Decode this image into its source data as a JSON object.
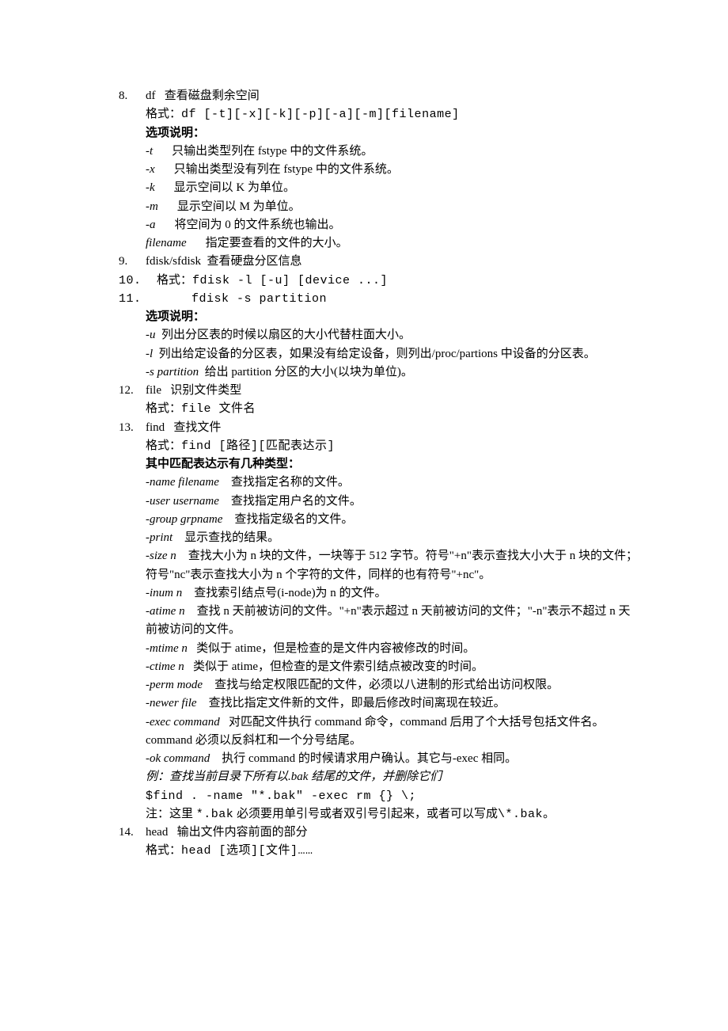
{
  "s8": {
    "num": "8.",
    "title_cmd": "df",
    "title_desc": "查看磁盘剩余空间",
    "format_label": "格式：",
    "format_code": "df [-t][-x][-k][-p][-a][-m][filename]",
    "options_label": "选项说明：",
    "opts": [
      {
        "flag": "-t",
        "desc": "只输出类型列在 fstype 中的文件系统。"
      },
      {
        "flag": "-x",
        "desc": "只输出类型没有列在 fstype 中的文件系统。"
      },
      {
        "flag": "-k",
        "desc": "显示空间以 K 为单位。"
      },
      {
        "flag": "-m",
        "desc": "显示空间以 M 为单位。"
      },
      {
        "flag": "-a",
        "desc": "将空间为 0 的文件系统也输出。"
      }
    ],
    "filename_flag": "filename",
    "filename_desc": "指定要查看的文件的大小。"
  },
  "s9": {
    "num": "9.",
    "title_cmd": "fdisk/sfdisk",
    "title_desc": "查看硬盘分区信息"
  },
  "s10": {
    "num": "10.",
    "label": "格式：",
    "code": "fdisk -l [-u] [device ...]"
  },
  "s11": {
    "num": "11.",
    "code": "fdisk -s partition",
    "options_label": "选项说明：",
    "opt_u_flag": "-u",
    "opt_u_desc": "列出分区表的时候以扇区的大小代替柱面大小。",
    "opt_l_flag": "-l",
    "opt_l_desc": "列出给定设备的分区表，如果没有给定设备，则列出/proc/partions 中设备的分区表。",
    "opt_s_flag": "-s partition",
    "opt_s_desc": "给出 partition 分区的大小(以块为单位)。"
  },
  "s12": {
    "num": "12.",
    "title_cmd": "file",
    "title_desc": "识别文件类型",
    "format_label": "格式：",
    "format_code": "file 文件名"
  },
  "s13": {
    "num": "13.",
    "title_cmd": "find",
    "title_desc": "查找文件",
    "format_label": "格式：",
    "format_code": "find [路径][匹配表达示]",
    "types_label": "其中匹配表达示有几种类型：",
    "opts": [
      {
        "flag": "-name filename",
        "desc": "查找指定名称的文件。"
      },
      {
        "flag": "-user username",
        "desc": "查找指定用户名的文件。"
      },
      {
        "flag": "-group grpname",
        "desc": "查找指定级名的文件。"
      },
      {
        "flag": "-print",
        "desc": "显示查找的结果。"
      },
      {
        "flag": "-size n",
        "desc": "查找大小为 n 块的文件，一块等于 512 字节。符号\"+n\"表示查找大小大于 n 块的文件；符号\"nc\"表示查找大小为 n 个字符的文件，同样的也有符号\"+nc\"。"
      },
      {
        "flag": "-inum n",
        "desc": "查找索引结点号(i-node)为 n 的文件。"
      },
      {
        "flag": "-atime n",
        "desc": "查找 n 天前被访问的文件。\"+n\"表示超过 n 天前被访问的文件；\"-n\"表示不超过 n 天前被访问的文件。"
      },
      {
        "flag": "-mtime n",
        "desc": "类似于 atime，但是检查的是文件内容被修改的时间。"
      },
      {
        "flag": "-ctime n",
        "desc": "类似于 atime，但检查的是文件索引结点被改变的时间。"
      },
      {
        "flag": "-perm mode",
        "desc": "查找与给定权限匹配的文件，必须以八进制的形式给出访问权限。"
      },
      {
        "flag": "-newer file",
        "desc": "查找比指定文件新的文件，即最后修改时间离现在较近。"
      },
      {
        "flag": "-exec command",
        "desc": "对匹配文件执行 command 命令，command 后用了个大括号包括文件名。command 必须以反斜杠和一个分号结尾。"
      },
      {
        "flag": "-ok command",
        "desc": "执行 command 的时候请求用户确认。其它与-exec 相同。"
      }
    ],
    "example_label": "例：查找当前目录下所有以.bak 结尾的文件，并删除它们",
    "example_code": " $find . -name \"*.bak\" -exec rm {} \\;",
    "note_prefix": "注：这里 ",
    "note_code": "*.bak",
    "note_suffix": " 必须要用单引号或者双引号引起来，或者可以写成",
    "note_code2": "\\*.bak",
    "note_end": "。"
  },
  "s14": {
    "num": "14.",
    "title_cmd": "head",
    "title_desc": "输出文件内容前面的部分",
    "format_label": "格式：",
    "format_code": "head [选项][文件]……"
  }
}
